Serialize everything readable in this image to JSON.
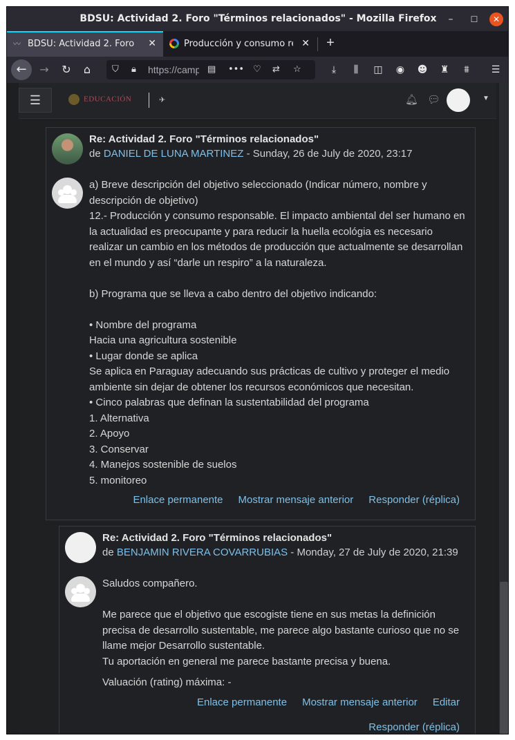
{
  "window": {
    "title": "BDSU: Actividad 2. Foro \"Términos relacionados\" - Mozilla Firefox",
    "min_glyph": "–",
    "max_glyph": "☐",
    "close_glyph": "✕"
  },
  "tabs": [
    {
      "label": "BDSU: Actividad 2. Foro \"",
      "icon": "moodle-favicon-icon",
      "active": true
    },
    {
      "label": "Producción y consumo re",
      "icon": "google-favicon-icon",
      "active": false
    }
  ],
  "navbar": {
    "url": "https://camp",
    "toolbar_icons": [
      "download-icon",
      "library-icon",
      "sidebar-icon",
      "account-icon",
      "extension-icon",
      "extension-icon",
      "extension-icon",
      "menu-icon"
    ]
  },
  "site": {
    "logo_text": "EDUCACIÓN"
  },
  "colors": {
    "link": "#7ec0e8",
    "background": "#1e1f21",
    "close_button": "#e95420"
  },
  "posts": [
    {
      "subject": "Re: Actividad 2. Foro \"Términos relacionados\"",
      "by_prefix": "de ",
      "author": "DANIEL DE LUNA MARTINEZ",
      "date": " - Sunday, 26 de July de 2020, 23:17",
      "paragraphs": [
        "a) Breve descripción del objetivo seleccionado (Indicar número, nombre y descripción de objetivo)",
        "12.- Producción y consumo responsable. El impacto ambiental del ser humano en la actualidad es preocupante y para reducir la huella ecológia es necesario realizar un cambio en los métodos de producción que actualmente se desarrollan en el mundo y así “darle un respiro” a la naturaleza.",
        "",
        "b) Programa que se lleva a cabo dentro del objetivo indicando:",
        "",
        "• Nombre del programa",
        "Hacia una agricultura sostenible",
        "• Lugar donde se aplica",
        "Se aplica en Paraguay adecuando sus prácticas de cultivo y proteger el medio ambiente sin dejar de obtener los recursos económicos que necesitan.",
        "• Cinco palabras que definan la sustentabilidad del programa",
        "1. Alternativa",
        "2. Apoyo",
        "3. Conservar",
        "4. Manejos sostenible de suelos",
        "5. monitoreo"
      ],
      "actions": [
        "Enlace permanente",
        "Mostrar mensaje anterior",
        "Responder (réplica)"
      ]
    },
    {
      "subject": "Re: Actividad 2. Foro \"Términos relacionados\"",
      "by_prefix": "de ",
      "author": "BENJAMIN RIVERA COVARRUBIAS",
      "date": " - Monday, 27 de July de 2020, 21:39",
      "paragraphs": [
        "Saludos compañero.",
        "",
        "Me parece que el objetivo que escogiste tiene en sus metas la definición precisa de desarrollo sustentable, me parece algo bastante curioso que no se llame mejor Desarrollo sustentable.",
        "Tu aportación en general me parece bastante precisa y buena."
      ],
      "rating": "Valuación (rating) máxima: -",
      "actions": [
        "Enlace permanente",
        "Mostrar mensaje anterior",
        "Editar"
      ],
      "actions2": [
        "Responder (réplica)"
      ]
    }
  ]
}
